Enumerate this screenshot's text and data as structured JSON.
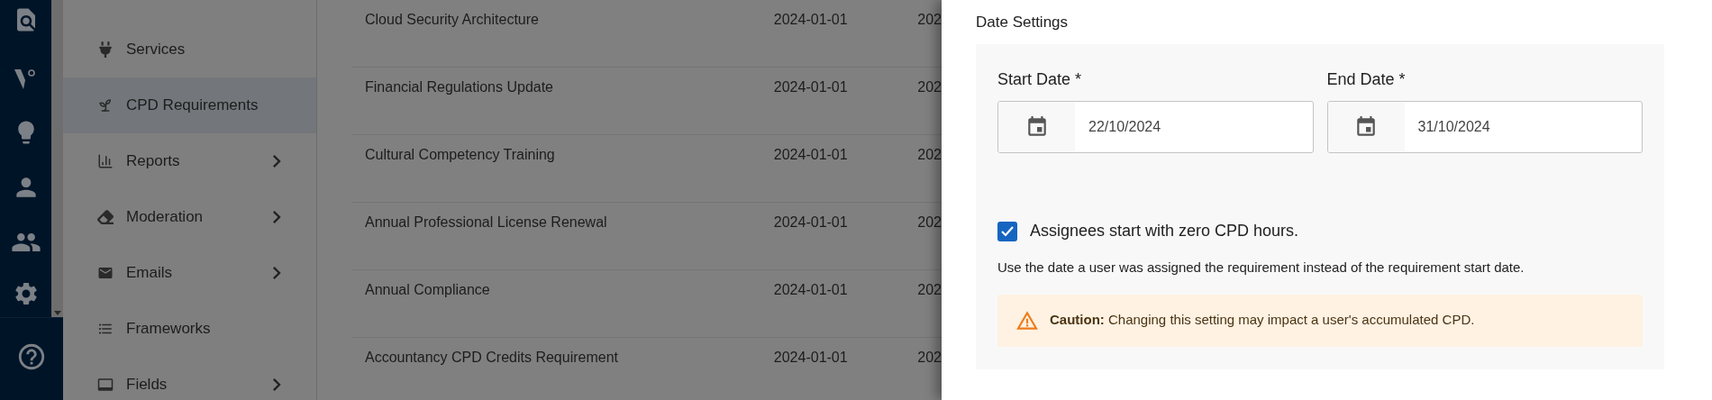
{
  "sidebar": {
    "items": [
      {
        "label": "Services",
        "expandable": false,
        "selected": false
      },
      {
        "label": "CPD Requirements",
        "expandable": false,
        "selected": true
      },
      {
        "label": "Reports",
        "expandable": true,
        "selected": false
      },
      {
        "label": "Moderation",
        "expandable": true,
        "selected": false
      },
      {
        "label": "Emails",
        "expandable": true,
        "selected": false
      },
      {
        "label": "Frameworks",
        "expandable": false,
        "selected": false
      },
      {
        "label": "Fields",
        "expandable": true,
        "selected": false
      }
    ]
  },
  "table": {
    "rows": [
      {
        "name": "Cloud Security Architecture",
        "start": "2024-01-01",
        "column_3": "202"
      },
      {
        "name": "Financial Regulations Update",
        "start": "2024-01-01",
        "column_3": "202"
      },
      {
        "name": "Cultural Competency Training",
        "start": "2024-01-01",
        "column_3": "202"
      },
      {
        "name": "Annual Professional License Renewal",
        "start": "2024-01-01",
        "column_3": "202"
      },
      {
        "name": "Annual Compliance",
        "start": "2024-01-01",
        "column_3": "202"
      },
      {
        "name": "Accountancy CPD Credits Requirement",
        "start": "2024-01-01",
        "column_3": "202"
      }
    ]
  },
  "panel": {
    "title": "Date Settings",
    "dates": [
      {
        "label": "Start Date *",
        "value": "22/10/2024"
      },
      {
        "label": "End Date *",
        "value": "31/10/2024"
      }
    ],
    "zero_hours": {
      "label": "Assignees start with zero CPD hours.",
      "checked": true
    },
    "helper": "Use the date a user was assigned the requirement instead of the requirement start date.",
    "caution": "**Caution:** Changing this setting may impact a user's accumulated CPD."
  }
}
